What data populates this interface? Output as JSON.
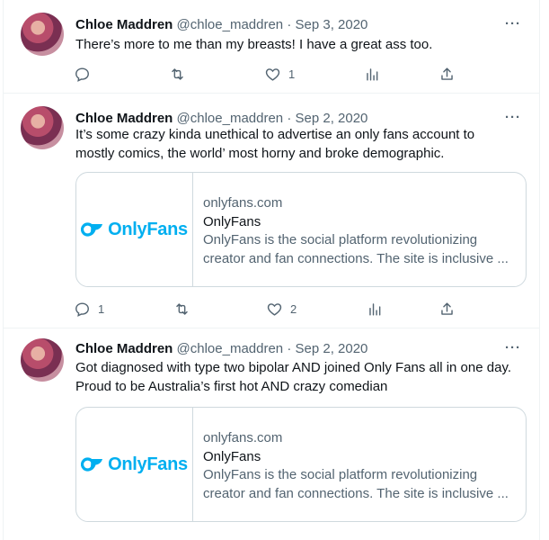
{
  "tweets": [
    {
      "name": "Chloe Maddren",
      "handle": "@chloe_maddren",
      "separator": "·",
      "date": "Sep 3, 2020",
      "more": "···",
      "text": "There’s more to me than my breasts! I have a great ass too.",
      "reply_count": "",
      "retweet_count": "",
      "like_count": "1",
      "view_count": ""
    },
    {
      "name": "Chloe Maddren",
      "handle": "@chloe_maddren",
      "separator": "·",
      "date": "Sep 2, 2020",
      "more": "···",
      "text_lines": [
        "It’s some crazy kinda unethical to advertise an only fans account to",
        "mostly comics, the world’ most horny and broke demographic."
      ],
      "card": {
        "logo_text": "OnlyFans",
        "domain": "onlyfans.com",
        "title": "OnlyFans",
        "desc_lines": [
          "OnlyFans is the social platform revolutionizing",
          "creator and fan connections. The site is inclusive ..."
        ]
      },
      "reply_count": "1",
      "retweet_count": "",
      "like_count": "2",
      "view_count": ""
    },
    {
      "name": "Chloe Maddren",
      "handle": "@chloe_maddren",
      "separator": "·",
      "date": "Sep 2, 2020",
      "more": "···",
      "text_lines": [
        "Got diagnosed with type two bipolar AND joined Only Fans all in one day.",
        "Proud to be Australia’s first hot AND crazy comedian"
      ],
      "card": {
        "logo_text": "OnlyFans",
        "domain": "onlyfans.com",
        "title": "OnlyFans",
        "desc_lines": [
          "OnlyFans is the social platform revolutionizing",
          "creator and fan connections. The site is inclusive ..."
        ]
      }
    }
  ],
  "colors": {
    "text": "#0f1419",
    "muted": "#536471",
    "border": "#cfd9de",
    "brand": "#00aff0"
  },
  "icons": [
    "reply-icon",
    "retweet-icon",
    "like-icon",
    "views-icon",
    "share-icon",
    "more-icon",
    "onlyfans-logo-icon"
  ]
}
